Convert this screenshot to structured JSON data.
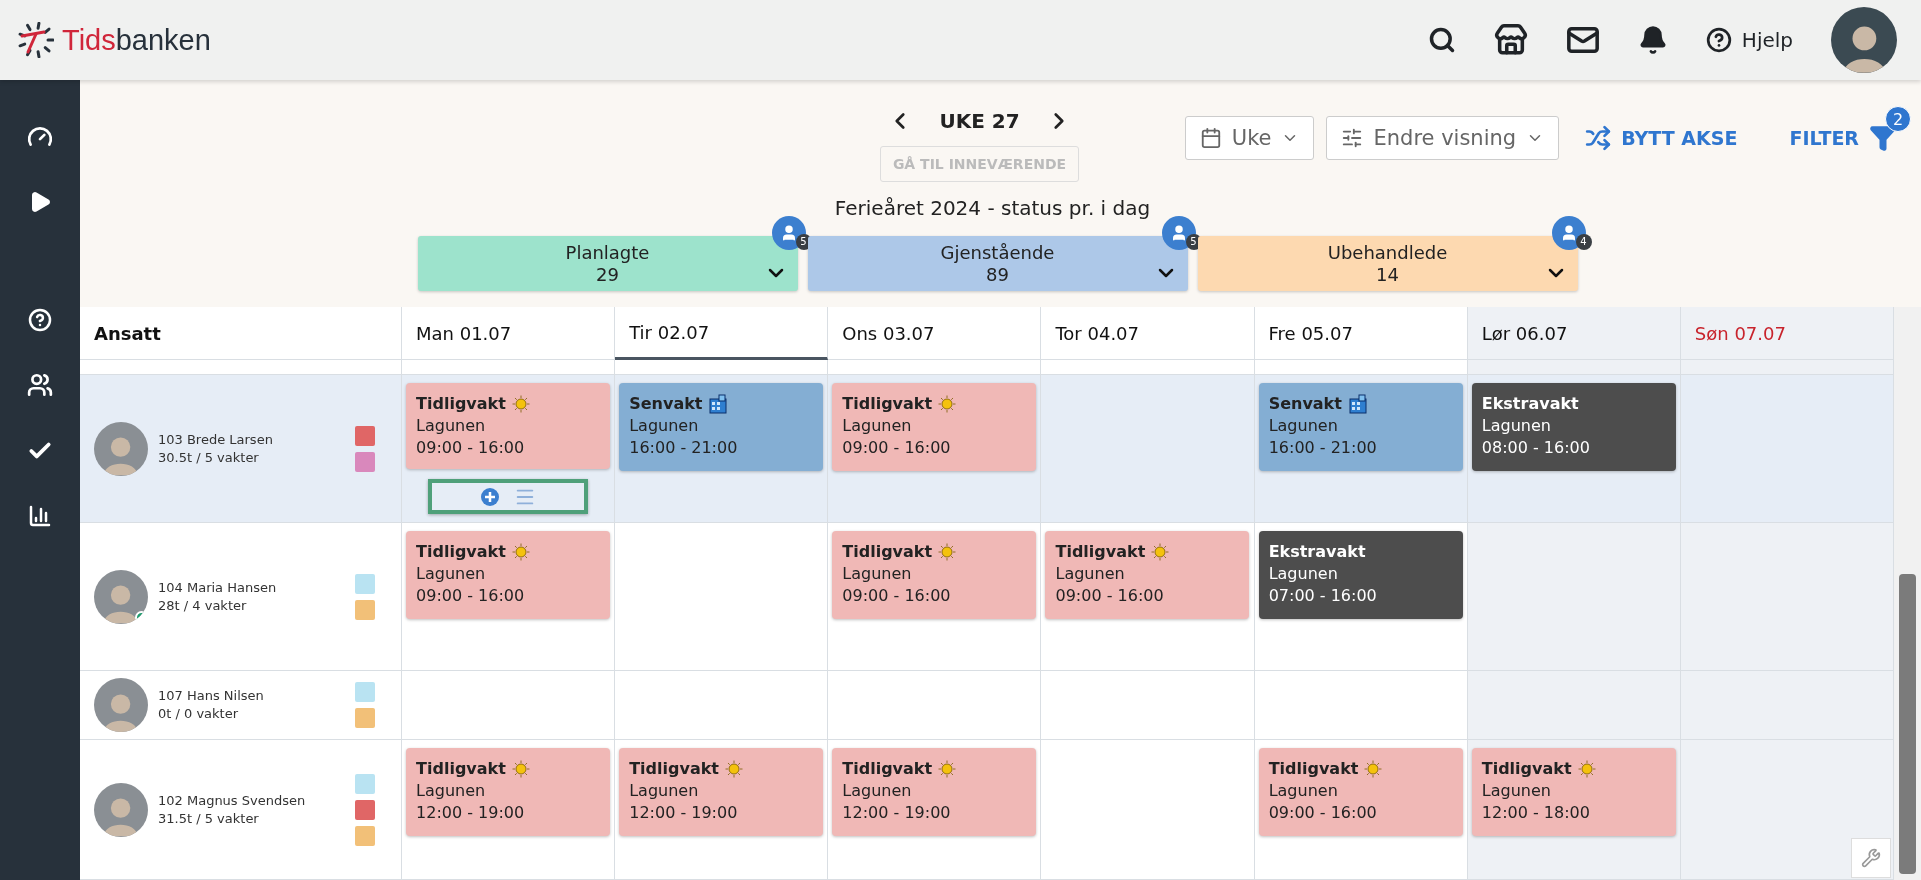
{
  "header": {
    "logo": {
      "part1": "Tids",
      "part2": "banken"
    },
    "help_label": "Hjelp"
  },
  "week_nav": {
    "label": "UKE 27",
    "go_current": {
      "label": "GÅ TIL INNEVÆRENDE",
      "disabled": true
    }
  },
  "view_controls": {
    "period": "Uke",
    "view": "Endre visning",
    "swap_axis": "BYTT AKSE",
    "filter": {
      "label": "FILTER",
      "count": "2"
    }
  },
  "vacation": {
    "title": "Ferieåret 2024 - status pr. i dag",
    "cards": [
      {
        "label": "Planlagte",
        "value": "29",
        "color": "#9de3cc",
        "people": "5"
      },
      {
        "label": "Gjenstående",
        "value": "89",
        "color": "#adc8e8",
        "people": "5"
      },
      {
        "label": "Ubehandlede",
        "value": "14",
        "color": "#fdd9b0",
        "people": "4"
      }
    ]
  },
  "table": {
    "employee_header": "Ansatt",
    "days": [
      {
        "label": "Man 01.07",
        "kind": "weekday",
        "selected": false
      },
      {
        "label": "Tir 02.07",
        "kind": "weekday",
        "selected": true
      },
      {
        "label": "Ons 03.07",
        "kind": "weekday",
        "selected": false
      },
      {
        "label": "Tor 04.07",
        "kind": "weekday",
        "selected": false
      },
      {
        "label": "Fre 05.07",
        "kind": "weekday",
        "selected": false
      },
      {
        "label": "Lør 06.07",
        "kind": "saturday",
        "selected": false
      },
      {
        "label": "Søn 07.07",
        "kind": "sunday",
        "selected": false
      }
    ],
    "employees": [
      {
        "name": "103 Brede Larsen",
        "hours": "30.5t / 5 vakter",
        "online": false,
        "selected": true,
        "tags": [
          {
            "color": "#e06666"
          },
          {
            "color": "#d988bc"
          }
        ],
        "cells": [
          {
            "shift": {
              "kind": "early",
              "title": "Tidligvakt",
              "location": "Lagunen",
              "time": "09:00 - 16:00"
            },
            "toolbar": true
          },
          {
            "shift": {
              "kind": "late",
              "title": "Senvakt",
              "location": "Lagunen",
              "time": "16:00 - 21:00"
            },
            "toolbar": false
          },
          {
            "shift": {
              "kind": "early",
              "title": "Tidligvakt",
              "location": "Lagunen",
              "time": "09:00 - 16:00"
            },
            "toolbar": false
          },
          {
            "toolbar": false
          },
          {
            "shift": {
              "kind": "late",
              "title": "Senvakt",
              "location": "Lagunen",
              "time": "16:00 - 21:00"
            },
            "toolbar": false
          },
          {
            "shift": {
              "kind": "extra",
              "title": "Ekstravakt",
              "location": "Lagunen",
              "time": "08:00 - 16:00"
            },
            "toolbar": false
          },
          {
            "toolbar": false
          }
        ]
      },
      {
        "name": "104 Maria Hansen",
        "hours": "28t / 4 vakter",
        "online": true,
        "selected": false,
        "tags": [
          {
            "color": "#b9e3f2"
          },
          {
            "color": "#f2c078"
          }
        ],
        "cells": [
          {
            "shift": {
              "kind": "early",
              "title": "Tidligvakt",
              "location": "Lagunen",
              "time": "09:00 - 16:00"
            },
            "toolbar": false
          },
          {
            "toolbar": false
          },
          {
            "shift": {
              "kind": "early",
              "title": "Tidligvakt",
              "location": "Lagunen",
              "time": "09:00 - 16:00"
            },
            "toolbar": false
          },
          {
            "shift": {
              "kind": "early",
              "title": "Tidligvakt",
              "location": "Lagunen",
              "time": "09:00 - 16:00"
            },
            "toolbar": false
          },
          {
            "shift": {
              "kind": "extra",
              "title": "Ekstravakt",
              "location": "Lagunen",
              "time": "07:00 - 16:00"
            },
            "toolbar": false
          },
          {
            "toolbar": false
          },
          {
            "toolbar": false
          }
        ]
      },
      {
        "name": "107 Hans Nilsen",
        "hours": "0t / 0 vakter",
        "online": false,
        "selected": false,
        "tags": [
          {
            "color": "#b9e3f2"
          },
          {
            "color": "#f2c078"
          }
        ],
        "cells": [
          {
            "toolbar": false
          },
          {
            "toolbar": false
          },
          {
            "toolbar": false
          },
          {
            "toolbar": false
          },
          {
            "toolbar": false
          },
          {
            "toolbar": false
          },
          {
            "toolbar": false
          }
        ]
      },
      {
        "name": "102 Magnus Svendsen",
        "hours": "31.5t / 5 vakter",
        "online": false,
        "selected": false,
        "tags": [
          {
            "color": "#b9e3f2"
          },
          {
            "color": "#e06666"
          },
          {
            "color": "#f2c078"
          }
        ],
        "cells": [
          {
            "shift": {
              "kind": "early",
              "title": "Tidligvakt",
              "location": "Lagunen",
              "time": "12:00 - 19:00"
            },
            "toolbar": false
          },
          {
            "shift": {
              "kind": "early",
              "title": "Tidligvakt",
              "location": "Lagunen",
              "time": "12:00 - 19:00"
            },
            "toolbar": false
          },
          {
            "shift": {
              "kind": "early",
              "title": "Tidligvakt",
              "location": "Lagunen",
              "time": "12:00 - 19:00"
            },
            "toolbar": false
          },
          {
            "toolbar": false
          },
          {
            "shift": {
              "kind": "early",
              "title": "Tidligvakt",
              "location": "Lagunen",
              "time": "09:00 - 16:00"
            },
            "toolbar": false
          },
          {
            "shift": {
              "kind": "early",
              "title": "Tidligvakt",
              "location": "Lagunen",
              "time": "12:00 - 18:00"
            },
            "toolbar": false
          },
          {
            "toolbar": false
          }
        ]
      }
    ]
  }
}
